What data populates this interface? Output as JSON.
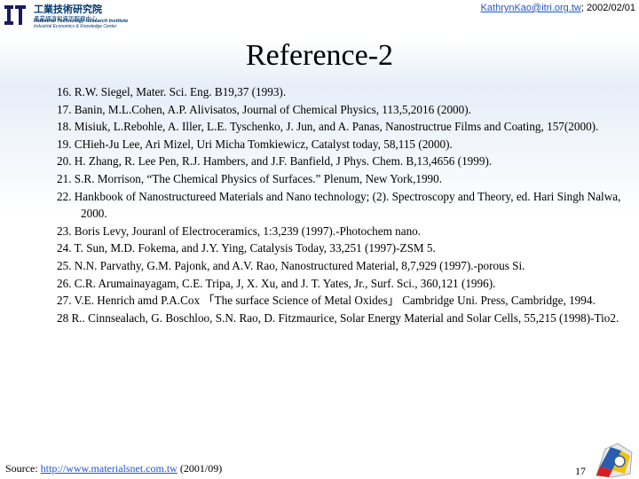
{
  "header": {
    "org_name_zh": "工業技術研究院",
    "org_subtitle_zh": "產業經濟與資訊服務中心",
    "org_name_en": "Industrial Technology Research Institute",
    "org_subtitle_en": "Industrial Economics & Knowledge Center",
    "email_link": "KathrynKao@itri.org.tw",
    "date_text": "; 2002/02/01"
  },
  "title": "Reference-2",
  "references": [
    "16. R.W. Siegel, Mater. Sci. Eng. B19,37 (1993).",
    "17. Banin, M.L.Cohen, A.P. Alivisatos, Journal of Chemical Physics, 113,5,2016 (2000).",
    "18. Misiuk, L.Rebohle, A. Iller, L.E. Tyschenko, J. Jun, and A. Panas, Nanostructrue Films and Coating, 157(2000).",
    "19. CHieh-Ju Lee, Ari Mizel, Uri Micha Tomkiewicz, Catalyst today, 58,115 (2000).",
    "20. H. Zhang, R. Lee Pen, R.J. Hambers, and J.F. Banfield, J Phys. Chem. B,13,4656 (1999).",
    "21. S.R. Morrison, “The Chemical Physics of Surfaces.” Plenum, New York,1990.",
    "22. Hankbook of Nanostructureed Materials and Nano technology; (2). Spectroscopy and Theory, ed. Hari Singh Nalwa, 2000.",
    "23. Boris Levy, Jouranl of Electroceramics, 1:3,239 (1997).-Photochem nano.",
    "24. T. Sun, M.D. Fokema, and J.Y. Ying, Catalysis Today, 33,251 (1997)-ZSM 5.",
    "25. N.N. Parvathy, G.M. Pajonk, and A.V. Rao, Nanostructured Material, 8,7,929 (1997).-porous Si.",
    "26. C.R. Arumainayagam, C.E. Tripa, J, X. Xu, and J. T. Yates, Jr., Surf. Sci., 360,121 (1996).",
    "27. V.E. Henrich amd P.A.Cox 「The surface Science of Metal Oxides」 Cambridge Uni. Press, Cambridge, 1994.",
    "28 R.. Cinnsealach, G. Boschloo, S.N. Rao, D. Fitzmaurice, Solar Energy Material and Solar Cells, 55,215 (1998)-Tio2."
  ],
  "footer": {
    "source_label": "Source: ",
    "source_link": "http://www.materialsnet.com.tw",
    "source_date": " (2001/09)",
    "page_number": "17"
  },
  "colors": {
    "link": "#2255cc",
    "logo_blue": "#003a70",
    "logo_dark": "#1a1a5e"
  }
}
